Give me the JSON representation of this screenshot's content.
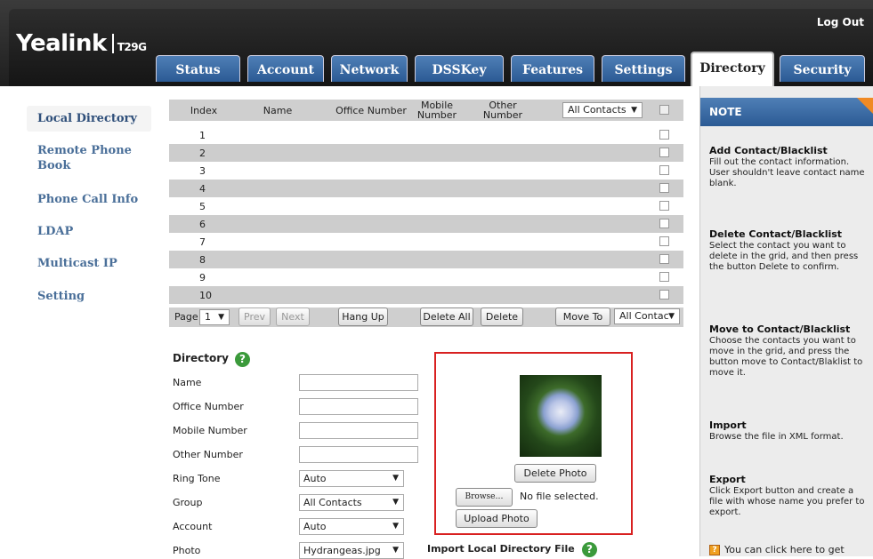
{
  "header": {
    "logo": "Yealink",
    "model": "T29G",
    "logout": "Log Out",
    "tabs": [
      {
        "label": "Status"
      },
      {
        "label": "Account"
      },
      {
        "label": "Network"
      },
      {
        "label": "DSSKey"
      },
      {
        "label": "Features"
      },
      {
        "label": "Settings"
      },
      {
        "label": "Directory",
        "active": true
      },
      {
        "label": "Security"
      }
    ]
  },
  "sidebar": {
    "items": [
      {
        "label": "Local Directory",
        "active": true
      },
      {
        "label": "Remote Phone Book"
      },
      {
        "label": "Phone Call Info"
      },
      {
        "label": "LDAP"
      },
      {
        "label": "Multicast IP"
      },
      {
        "label": "Setting"
      }
    ]
  },
  "grid": {
    "columns": [
      "Index",
      "Name",
      "Office Number",
      "Mobile Number",
      "Other Number"
    ],
    "filter": "All Contacts",
    "rows": [
      "1",
      "2",
      "3",
      "4",
      "5",
      "6",
      "7",
      "8",
      "9",
      "10"
    ]
  },
  "pager": {
    "page_label": "Page",
    "page_value": "1",
    "prev": "Prev",
    "next": "Next",
    "hang_up": "Hang Up",
    "delete_all": "Delete All",
    "delete": "Delete",
    "move_to": "Move To",
    "move_target": "All Contac"
  },
  "form": {
    "title": "Directory",
    "help": "?",
    "fields": {
      "name": "Name",
      "office": "Office Number",
      "mobile": "Mobile Number",
      "other": "Other Number",
      "ring_tone": "Ring Tone",
      "group": "Group",
      "account": "Account",
      "photo": "Photo"
    },
    "values": {
      "ring_tone": "Auto",
      "group": "All Contacts",
      "account": "Auto",
      "photo": "Hydrangeas.jpg"
    },
    "photo_box": {
      "delete_photo": "Delete Photo",
      "browse": "Browse…",
      "no_file": "No file selected.",
      "upload_photo": "Upload Photo"
    },
    "import_title": "Import Local Directory File"
  },
  "note": {
    "header": "NOTE",
    "sections": [
      {
        "title": "Add Contact/Blacklist",
        "text": "Fill out the contact information. User shouldn't leave contact name blank."
      },
      {
        "title": "Delete Contact/Blacklist",
        "text": "Select the contact you want to delete in the grid, and then press the button Delete to confirm."
      },
      {
        "title": "Move to Contact/Blacklist",
        "text": "Choose the contacts you want to move in the grid, and press the button move to Contact/Blaklist to move it."
      },
      {
        "title": "Import",
        "text": "Browse the file in XML format."
      },
      {
        "title": "Export",
        "text": "Click Export button and create a file with whose name you prefer to export."
      }
    ],
    "tip": "You can click here to get"
  }
}
